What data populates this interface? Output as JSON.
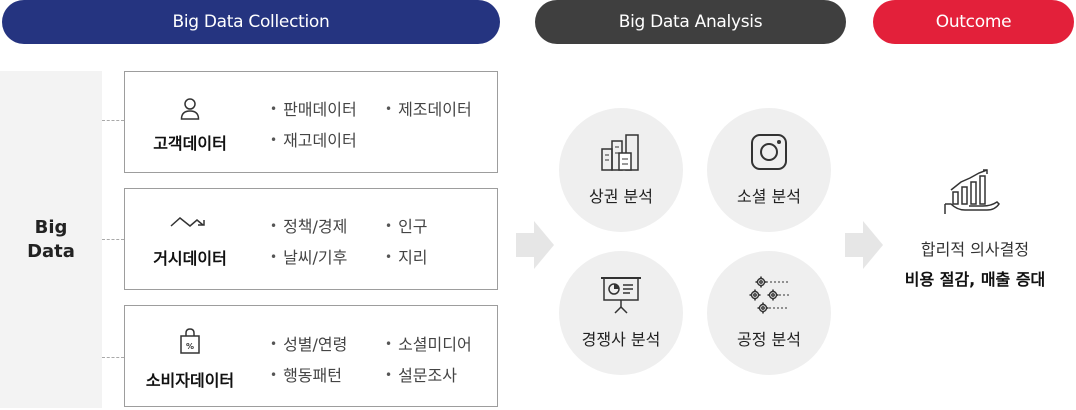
{
  "headers": {
    "collection": "Big Data Collection",
    "analysis": "Big Data Analysis",
    "outcome": "Outcome"
  },
  "big_data": {
    "line1": "Big",
    "line2": "Data"
  },
  "sources": [
    {
      "icon": "person-icon",
      "title": "고객데이터",
      "items": [
        "판매데이터",
        "제조데이터",
        "재고데이터"
      ]
    },
    {
      "icon": "trend-icon",
      "title": "거시데이터",
      "items": [
        "정책/경제",
        "인구",
        "날씨/기후",
        "지리"
      ]
    },
    {
      "icon": "shopping-bag-icon",
      "title": "소비자데이터",
      "items": [
        "성별/연령",
        "소셜미디어",
        "행동패턴",
        "설문조사"
      ]
    }
  ],
  "analyses": [
    {
      "icon": "buildings-icon",
      "label": "상권 분석"
    },
    {
      "icon": "instagram-icon",
      "label": "소셜 분석"
    },
    {
      "icon": "presentation-icon",
      "label": "경쟁사 분석"
    },
    {
      "icon": "gears-icon",
      "label": "공정 분석"
    }
  ],
  "outcome": {
    "icon": "growth-chart-hand-icon",
    "line1": "합리적 의사결정",
    "line2": "비용 절감, 매출 증대"
  },
  "colors": {
    "collection": "#253480",
    "analysis": "#3f3f3f",
    "outcome": "#e3203a",
    "panel": "#f3f3f3",
    "circle": "#efefef",
    "arrow": "#e6e6e6"
  }
}
